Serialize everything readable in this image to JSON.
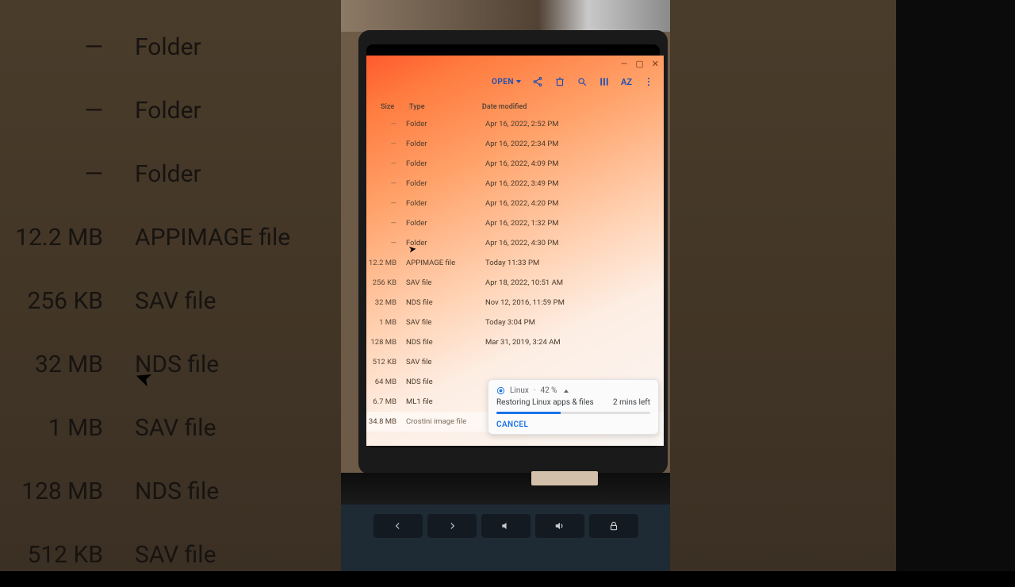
{
  "bg_rows": [
    {
      "size": "—",
      "type": "Folder"
    },
    {
      "size": "—",
      "type": "Folder"
    },
    {
      "size": "—",
      "type": "Folder"
    },
    {
      "size": "12.2 MB",
      "type": "APPIMAGE file"
    },
    {
      "size": "256 KB",
      "type": "SAV file"
    },
    {
      "size": "32 MB",
      "type": "NDS file"
    },
    {
      "size": "1 MB",
      "type": "SAV file"
    },
    {
      "size": "128 MB",
      "type": "NDS file"
    },
    {
      "size": "512 KB",
      "type": "SAV file"
    }
  ],
  "toolbar": {
    "open_label": "OPEN"
  },
  "columns": {
    "size": "Size",
    "type": "Type",
    "date": "Date modified"
  },
  "files": [
    {
      "size": "—",
      "type": "Folder",
      "date": "Apr 16, 2022, 2:52 PM"
    },
    {
      "size": "—",
      "type": "Folder",
      "date": "Apr 16, 2022, 2:34 PM"
    },
    {
      "size": "—",
      "type": "Folder",
      "date": "Apr 16, 2022, 4:09 PM"
    },
    {
      "size": "—",
      "type": "Folder",
      "date": "Apr 16, 2022, 3:49 PM"
    },
    {
      "size": "—",
      "type": "Folder",
      "date": "Apr 16, 2022, 4:20 PM"
    },
    {
      "size": "—",
      "type": "Folder",
      "date": "Apr 16, 2022, 1:32 PM"
    },
    {
      "size": "—",
      "type": "Folder",
      "date": "Apr 16, 2022, 4:30 PM"
    },
    {
      "size": "12.2 MB",
      "type": "APPIMAGE file",
      "date": "Today 11:33 PM"
    },
    {
      "size": "256 KB",
      "type": "SAV file",
      "date": "Apr 18, 2022, 10:51 AM"
    },
    {
      "size": "32 MB",
      "type": "NDS file",
      "date": "Nov 12, 2016, 11:59 PM"
    },
    {
      "size": "1 MB",
      "type": "SAV file",
      "date": "Today 3:04 PM"
    },
    {
      "size": "128 MB",
      "type": "NDS file",
      "date": "Mar 31, 2019, 3:24 AM"
    },
    {
      "size": "512 KB",
      "type": "SAV file",
      "date": ""
    },
    {
      "size": "64 MB",
      "type": "NDS file",
      "date": ""
    },
    {
      "size": "6.7 MB",
      "type": "ML1 file",
      "date": ""
    },
    {
      "size": "34.8 MB",
      "type": "Crostini image file",
      "date": "",
      "selected": true
    }
  ],
  "notification": {
    "source": "Linux",
    "percent_text": "42 %",
    "percent_value": 42,
    "title": "Restoring Linux apps & files",
    "eta": "2 mins left",
    "cancel": "CANCEL"
  }
}
